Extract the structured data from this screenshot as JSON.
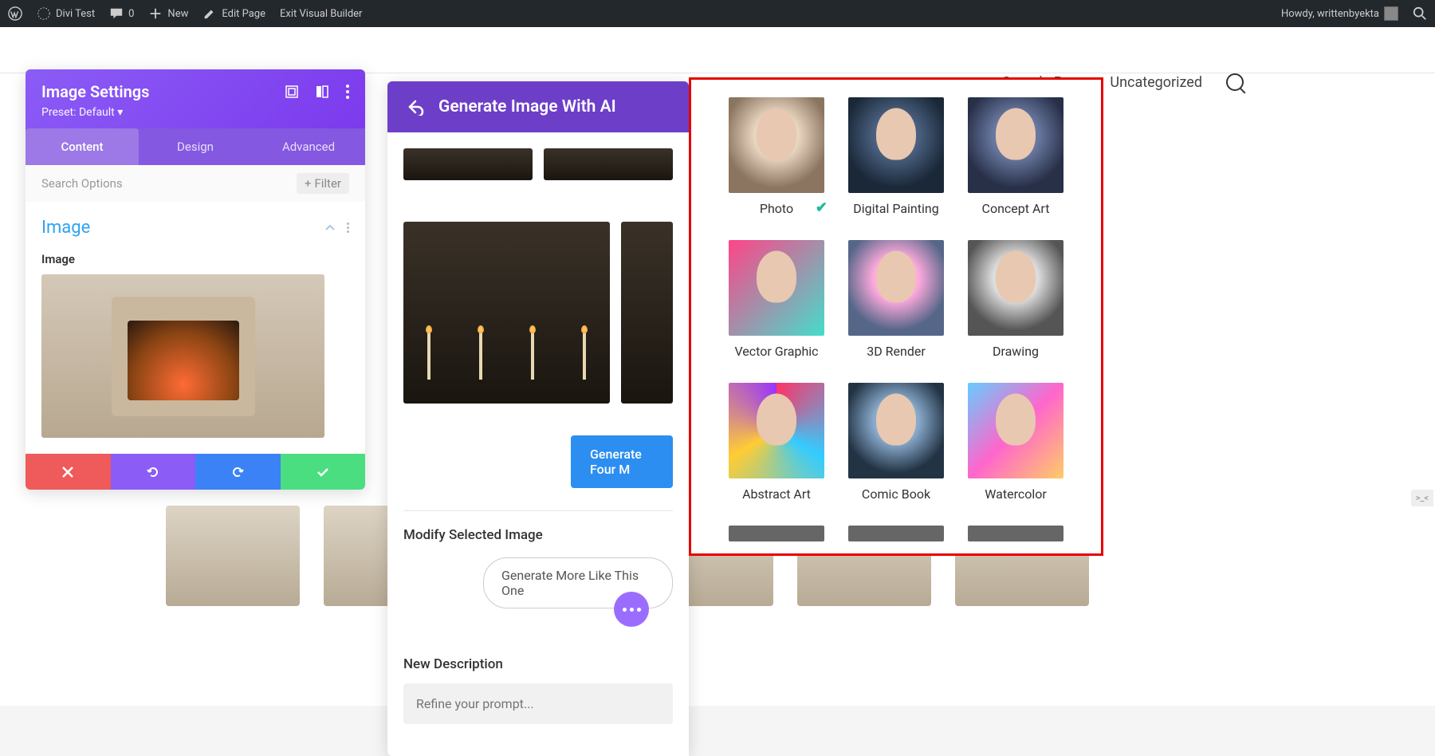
{
  "admin_bar": {
    "site_name": "Divi Test",
    "comments_count": "0",
    "new_label": "New",
    "edit_page": "Edit Page",
    "exit_builder": "Exit Visual Builder",
    "greeting": "Howdy, writtenbyekta"
  },
  "page_nav": {
    "item1": "Sample Page",
    "item2": "Uncategorized"
  },
  "settings": {
    "title": "Image Settings",
    "preset": "Preset: Default ▾",
    "tabs": {
      "content": "Content",
      "design": "Design",
      "advanced": "Advanced"
    },
    "search_placeholder": "Search Options",
    "filter_label": "Filter",
    "section_title": "Image",
    "field_label": "Image"
  },
  "ai": {
    "title": "Generate Image With AI",
    "generate_four": "Generate Four M",
    "modify_label": "Modify Selected Image",
    "more_like": "Generate More Like This One",
    "new_desc_label": "New Description",
    "refine_placeholder": "Refine your prompt..."
  },
  "styles": {
    "photo": "Photo",
    "digital": "Digital Painting",
    "concept": "Concept Art",
    "vector": "Vector Graphic",
    "render3d": "3D Render",
    "drawing": "Drawing",
    "abstract": "Abstract Art",
    "comic": "Comic Book",
    "watercolor": "Watercolor",
    "selected": "photo"
  },
  "colors": {
    "accent_purple": "#8b5cf6",
    "accent_blue": "#2c8ef0",
    "highlight_red": "#e60000"
  },
  "expand_tag": ">_<"
}
